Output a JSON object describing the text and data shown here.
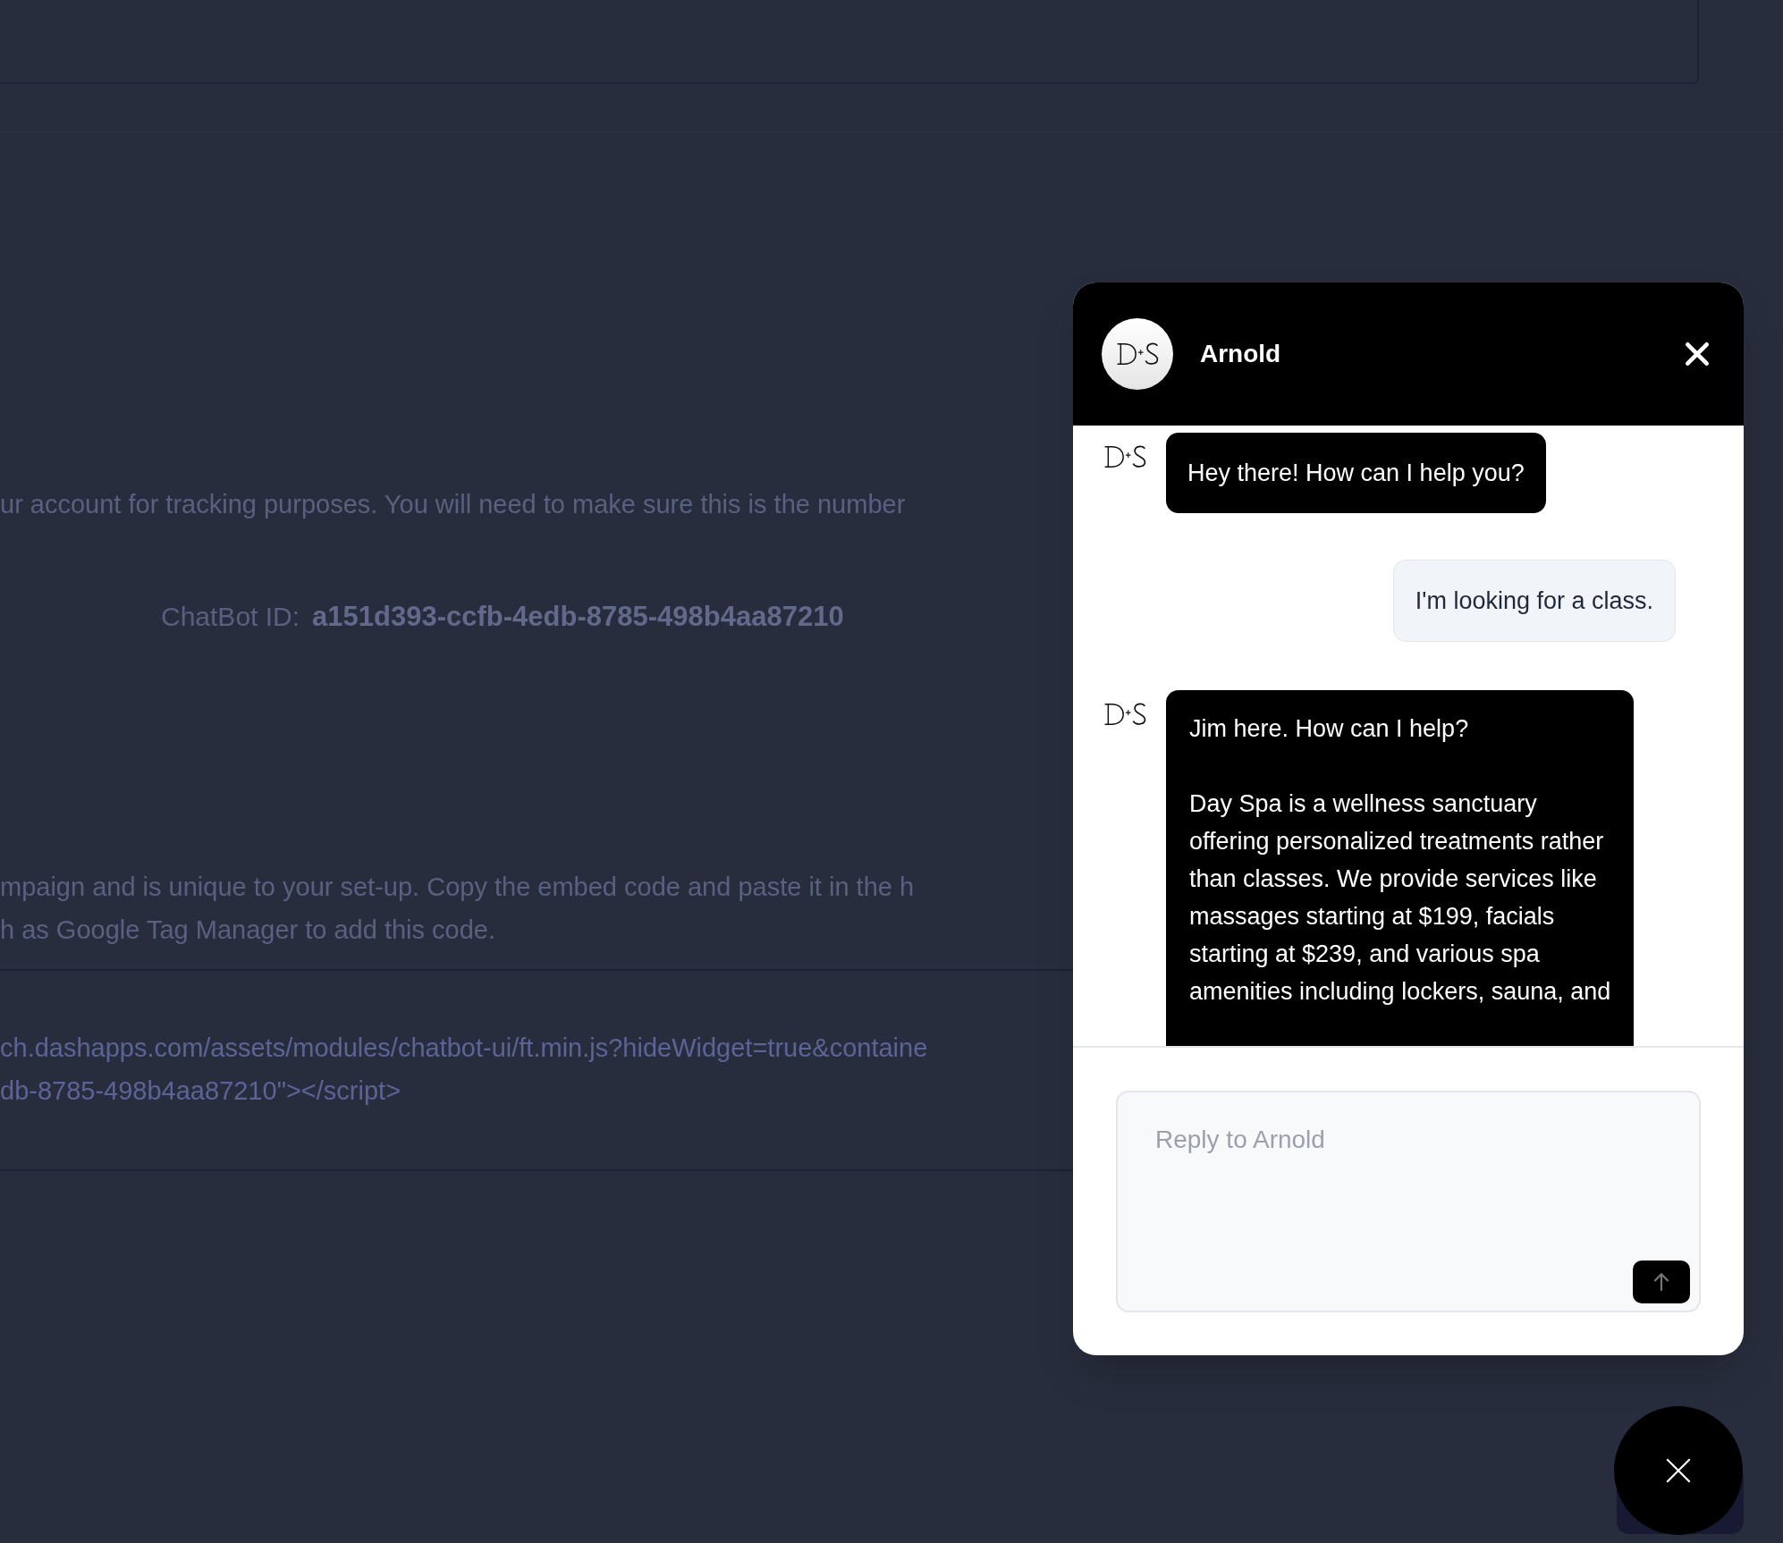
{
  "page": {
    "tracking_text": "ur account for tracking purposes. You will need to make sure this is the number",
    "chatbot_id_label": "ChatBot ID:",
    "chatbot_id": "a151d393-ccfb-4edb-8785-498b4aa87210",
    "embed_text_lines": [
      "mpaign and is unique to your set-up. Copy the embed code and paste it in the h",
      "h as Google Tag Manager to add this code."
    ],
    "embed_code_lines": [
      "ch.dashapps.com/assets/modules/chatbot-ui/ft.min.js?hideWidget=true&containe",
      "db-8785-498b4aa87210\"></script>"
    ]
  },
  "chat": {
    "agent_name": "Arnold",
    "messages": [
      {
        "kind": "bot",
        "paragraphs": [
          [
            "Hey there! How can I help you?"
          ]
        ]
      },
      {
        "kind": "user",
        "paragraphs": [
          [
            "I'm looking for a class."
          ]
        ]
      },
      {
        "kind": "bot",
        "paragraphs": [
          [
            "Jim here. How can I help?"
          ],
          [
            "Day Spa is a wellness sanctuary",
            "offering personalized treatments rather",
            "than classes. We provide services like",
            "massages starting at $199, facials",
            "starting at $239, and various spa",
            "amenities including lockers, sauna, and"
          ]
        ]
      }
    ],
    "reply": {
      "placeholder": "Reply to Arnold"
    }
  }
}
